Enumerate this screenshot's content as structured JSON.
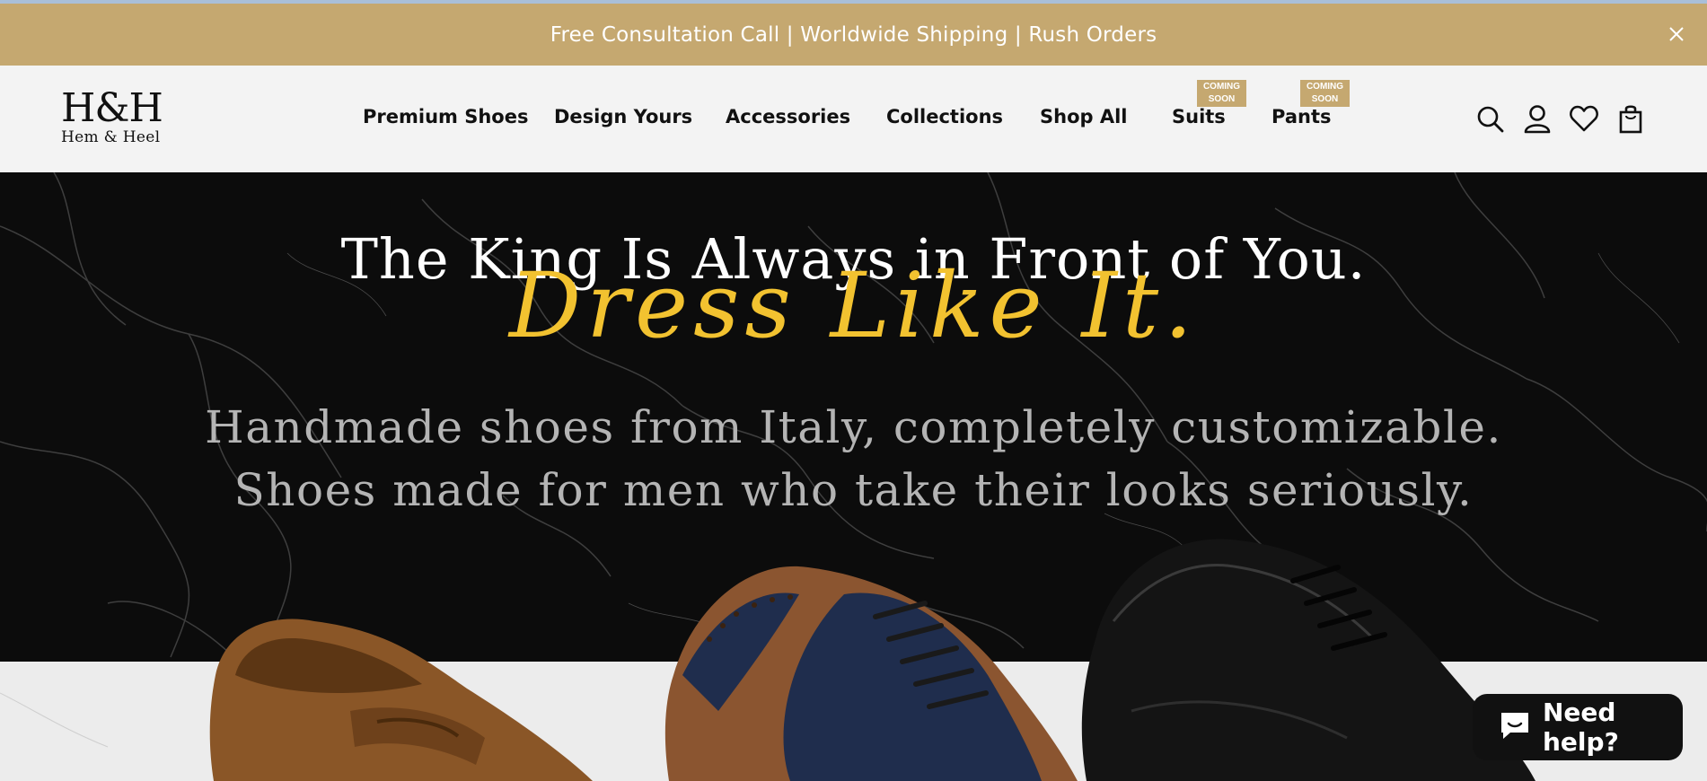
{
  "announcement": {
    "text": "Free Consultation Call | Worldwide Shipping | Rush Orders",
    "close_icon": "close-icon",
    "background": "#c5a870"
  },
  "brand": {
    "logo_mark": "H&H",
    "logo_subtitle": "Hem & Heel"
  },
  "nav": {
    "items": [
      {
        "label": "Premium Shoes"
      },
      {
        "label": "Design Yours"
      },
      {
        "label": "Accessories"
      },
      {
        "label": "Collections"
      },
      {
        "label": "Shop All"
      },
      {
        "label": "Suits",
        "badge": [
          "COMING",
          "SOON"
        ]
      },
      {
        "label": "Pants",
        "badge": [
          "COMING",
          "SOON"
        ]
      }
    ]
  },
  "header_icons": [
    "search-icon",
    "account-icon",
    "wishlist-heart-icon",
    "cart-bag-icon"
  ],
  "hero": {
    "headline": "The King Is Always in Front of You.",
    "headline_script": "Dress Like It.",
    "subtext_line1": "Handmade shoes from Italy, completely customizable.",
    "subtext_line2": "Shoes made for men who take their looks seriously.",
    "accent_color": "#f2c230",
    "products": [
      "brown-suede-penny-loafer",
      "navy-and-tan-brogue-oxford",
      "black-leather-oxford"
    ]
  },
  "chat_widget": {
    "label": "Need help?",
    "icon": "chat-bubble-icon"
  }
}
